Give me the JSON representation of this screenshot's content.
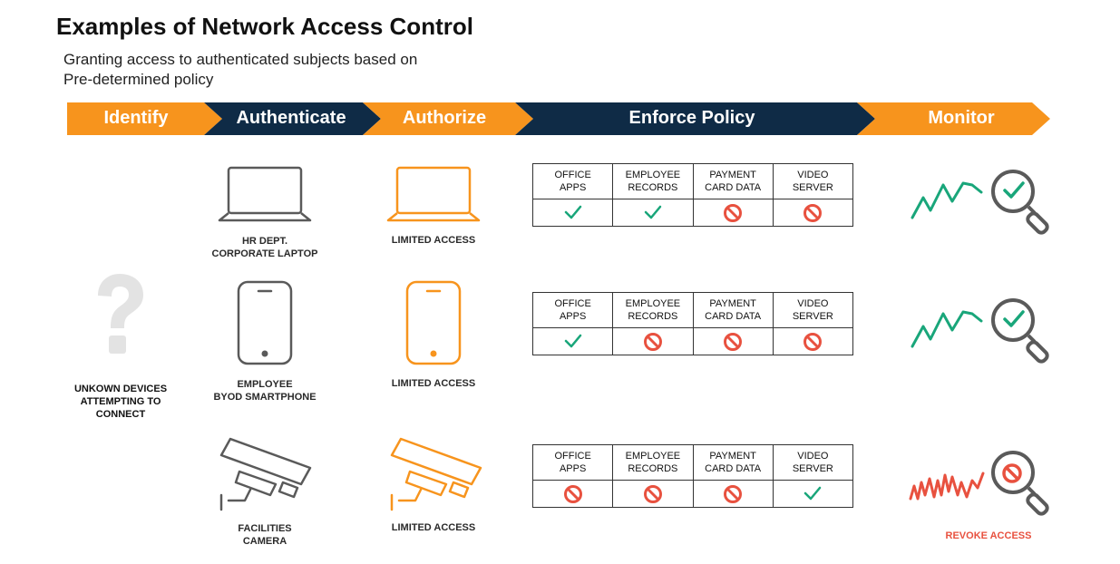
{
  "title": "Examples of Network Access Control",
  "subtitle_lines": [
    "Granting access to authenticated subjects based on",
    "Pre-determined policy"
  ],
  "stages": [
    {
      "label": "Identify",
      "color": "#f7941d"
    },
    {
      "label": "Authenticate",
      "color": "#0f2b46"
    },
    {
      "label": "Authorize",
      "color": "#f7941d"
    },
    {
      "label": "Enforce Policy",
      "color": "#0f2b46"
    },
    {
      "label": "Monitor",
      "color": "#f7941d"
    }
  ],
  "unknown": {
    "icon": "question-mark-icon",
    "lines": [
      "UNKOWN DEVICES",
      "ATTEMPTING TO",
      "CONNECT"
    ]
  },
  "colors": {
    "orange": "#f7941d",
    "navy": "#0f2b46",
    "gray_icon": "#5a5a5a",
    "allow": "#19a67a",
    "deny": "#e8513f",
    "question": "#e3e3e3"
  },
  "rows": [
    {
      "device_icon": "laptop-icon",
      "device_lines": [
        "HR DEPT.",
        "CORPORATE LAPTOP"
      ],
      "access_label": "LIMITED ACCESS",
      "headers": [
        [
          "OFFICE",
          "APPS"
        ],
        [
          "EMPLOYEE",
          "RECORDS"
        ],
        [
          "PAYMENT",
          "CARD DATA"
        ],
        [
          "VIDEO",
          "SERVER"
        ]
      ],
      "permissions": [
        "allow",
        "allow",
        "deny",
        "deny"
      ],
      "monitor": "ok"
    },
    {
      "device_icon": "smartphone-icon",
      "device_lines": [
        "EMPLOYEE",
        "BYOD SMARTPHONE"
      ],
      "access_label": "LIMITED ACCESS",
      "headers": [
        [
          "OFFICE",
          "APPS"
        ],
        [
          "EMPLOYEE",
          "RECORDS"
        ],
        [
          "PAYMENT",
          "CARD DATA"
        ],
        [
          "VIDEO",
          "SERVER"
        ]
      ],
      "permissions": [
        "allow",
        "deny",
        "deny",
        "deny"
      ],
      "monitor": "ok"
    },
    {
      "device_icon": "security-camera-icon",
      "device_lines": [
        "FACILITIES",
        "CAMERA"
      ],
      "access_label": "LIMITED ACCESS",
      "headers": [
        [
          "OFFICE",
          "APPS"
        ],
        [
          "EMPLOYEE",
          "RECORDS"
        ],
        [
          "PAYMENT",
          "CARD DATA"
        ],
        [
          "VIDEO",
          "SERVER"
        ]
      ],
      "permissions": [
        "deny",
        "deny",
        "deny",
        "allow"
      ],
      "monitor": "alert",
      "monitor_label": "REVOKE ACCESS"
    }
  ]
}
